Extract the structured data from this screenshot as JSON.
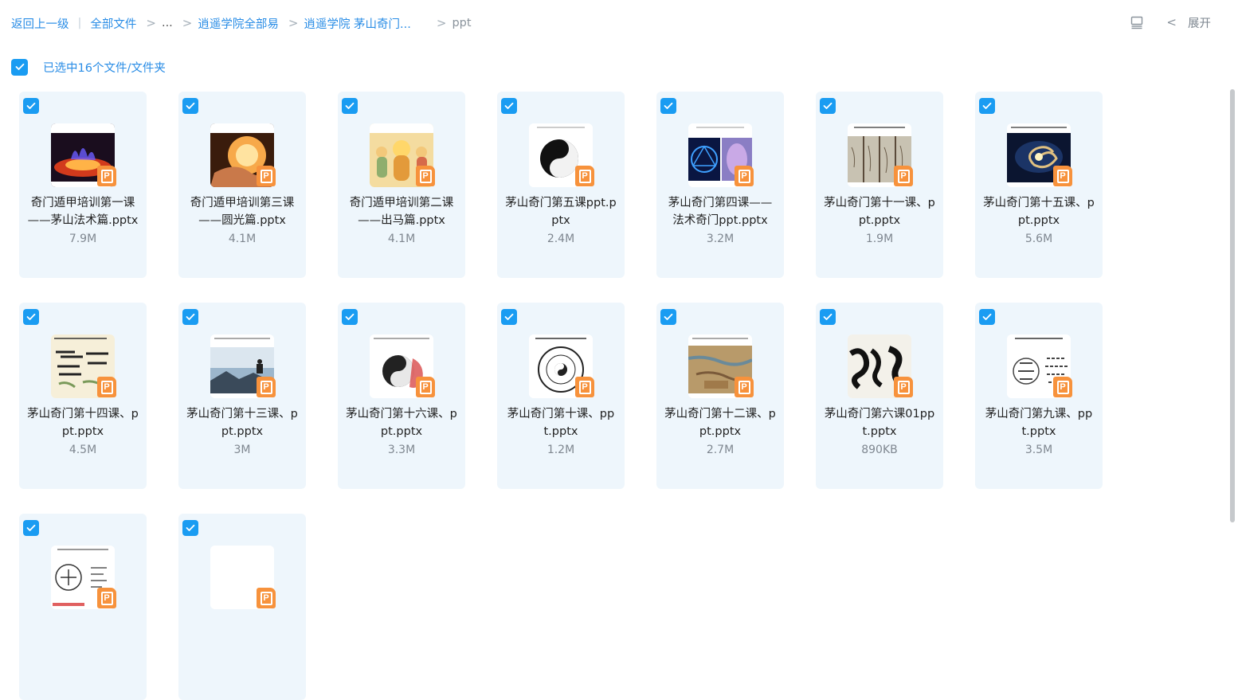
{
  "breadcrumb": {
    "back": "返回上一级",
    "all_files": "全部文件",
    "ellipsis": "...",
    "folder1": "逍遥学院全部易",
    "folder2": "逍遥学院 茅山奇门...",
    "current": "ppt"
  },
  "top_right": {
    "expand_label": "展开"
  },
  "selection": {
    "text": "已选中16个文件/文件夹"
  },
  "colors": {
    "accent": "#1a9cf2",
    "link": "#2a8de6",
    "card_bg": "#eef6fc",
    "ppt_badge": "#f7923c"
  },
  "files": [
    {
      "name": "奇门遁甲培训第一课——茅山法术篇.pptx",
      "size": "7.9M",
      "thumb": "fire-magic"
    },
    {
      "name": "奇门遁甲培训第三课——圆光篇.pptx",
      "size": "4.1M",
      "thumb": "glowing-hands"
    },
    {
      "name": "奇门遁甲培训第二课——出马篇.pptx",
      "size": "4.1M",
      "thumb": "deities"
    },
    {
      "name": "茅山奇门第五课ppt.pptx",
      "size": "2.4M",
      "thumb": "yin-yang"
    },
    {
      "name": "茅山奇门第四课——法术奇门ppt.pptx",
      "size": "3.2M",
      "thumb": "talisman"
    },
    {
      "name": "茅山奇门第十一课、ppt.pptx",
      "size": "1.9M",
      "thumb": "scrolls"
    },
    {
      "name": "茅山奇门第十五课、ppt.pptx",
      "size": "5.6M",
      "thumb": "galaxy"
    },
    {
      "name": "茅山奇门第十四课、ppt.pptx",
      "size": "4.5M",
      "thumb": "calligraphy"
    },
    {
      "name": "茅山奇门第十三课、ppt.pptx",
      "size": "3M",
      "thumb": "mountain"
    },
    {
      "name": "茅山奇门第十六课、ppt.pptx",
      "size": "3.3M",
      "thumb": "ink-taiji"
    },
    {
      "name": "茅山奇门第十课、ppt.pptx",
      "size": "1.2M",
      "thumb": "bagua-circle"
    },
    {
      "name": "茅山奇门第十二课、ppt.pptx",
      "size": "2.7M",
      "thumb": "old-map"
    },
    {
      "name": "茅山奇门第六课01ppt.pptx",
      "size": "890KB",
      "thumb": "ink-brush"
    },
    {
      "name": "茅山奇门第九课、ppt.pptx",
      "size": "3.5M",
      "thumb": "bagua-diagram"
    },
    {
      "name": "",
      "size": "",
      "thumb": "diagram-sheet"
    },
    {
      "name": "",
      "size": "",
      "thumb": "blank"
    }
  ]
}
